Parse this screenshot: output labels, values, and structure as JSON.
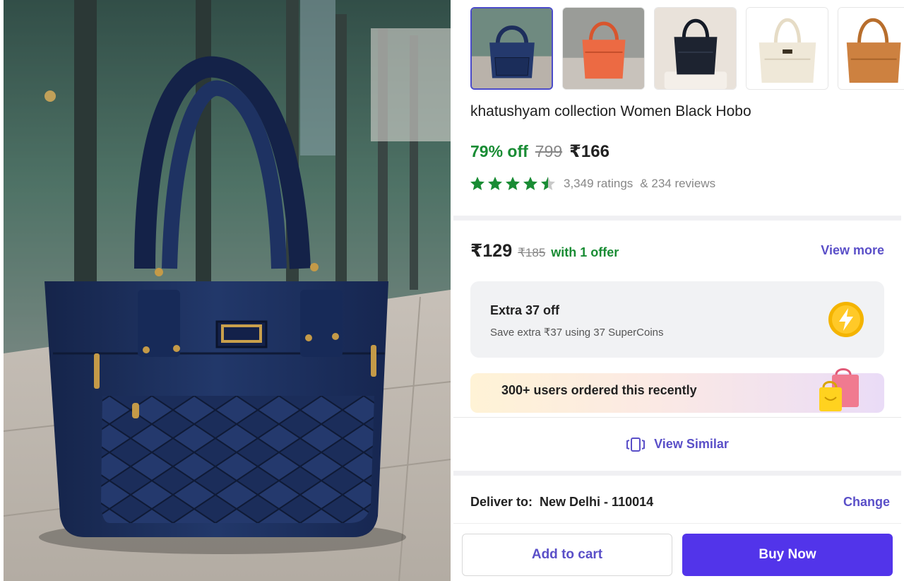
{
  "product": {
    "title": "khatushyam collection Women Black Hobo",
    "discount": "79% off",
    "mrp": "799",
    "price": "₹166",
    "rating_value": 4.5,
    "ratings_count": "3,349 ratings",
    "reviews_count": "& 234 reviews"
  },
  "thumbnails": [
    {
      "name": "thumb-navy-bag",
      "color": "#2c3f6b",
      "selected": true
    },
    {
      "name": "thumb-orange-bag",
      "color": "#e8603c",
      "selected": false
    },
    {
      "name": "thumb-black-bag",
      "color": "#1d2330",
      "selected": false
    },
    {
      "name": "thumb-cream-bag",
      "color": "#ece4d2",
      "selected": false
    },
    {
      "name": "thumb-tan-bag",
      "color": "#c77a35",
      "selected": false
    }
  ],
  "offer": {
    "price": "₹129",
    "mrp": "₹185",
    "label": "with 1 offer",
    "view_more": "View more"
  },
  "supercoins": {
    "title": "Extra 37 off",
    "subtitle": "Save extra ₹37 using 37 SuperCoins"
  },
  "social_proof": {
    "text": "300+ users ordered this recently"
  },
  "view_similar": {
    "label": "View Similar"
  },
  "delivery": {
    "label": "Deliver to:",
    "location": "New Delhi - 110014",
    "change": "Change"
  },
  "actions": {
    "add_to_cart": "Add to cart",
    "buy_now": "Buy Now"
  },
  "colors": {
    "accent": "#5a4fc8",
    "buy_button": "#5234ea",
    "discount_green": "#198c34",
    "star_green": "#198c34"
  }
}
